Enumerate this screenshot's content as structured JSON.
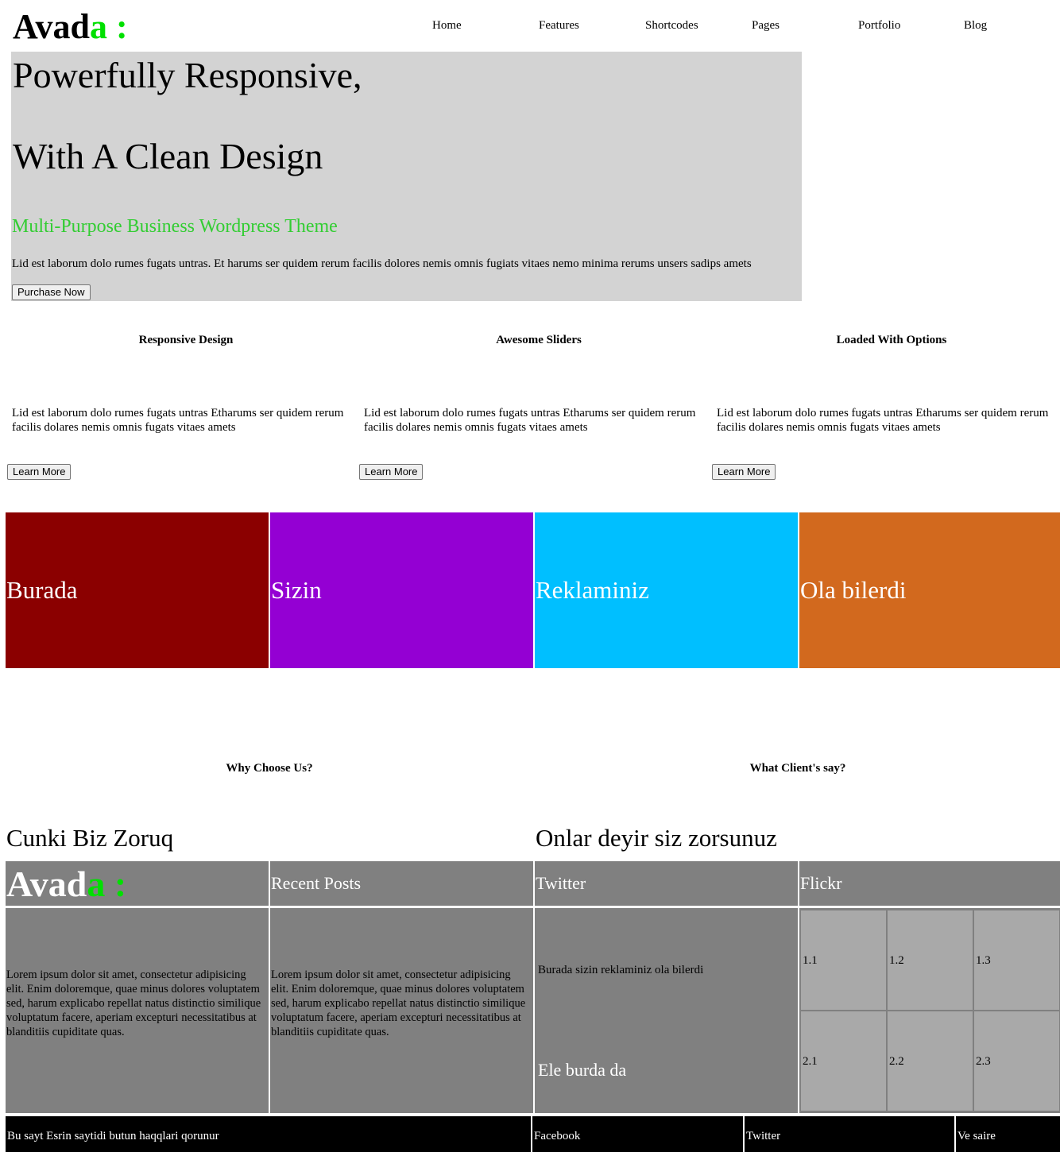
{
  "header": {
    "logo_main": "Avad",
    "logo_accent": "a :",
    "nav": [
      "Home",
      "Features",
      "Shortcodes",
      "Pages",
      "Portfolio",
      "Blog"
    ]
  },
  "hero": {
    "title_line1": "Powerfully Responsive,",
    "title_line2": "With A Clean Design",
    "subtitle": "Multi-Purpose Business Wordpress Theme",
    "text": "Lid est laborum dolo rumes fugats untras. Et harums ser quidem rerum facilis dolores nemis omnis fugiats vitaes nemo minima rerums unsers sadips amets",
    "button": "Purchase Now",
    "background": "#d3d3d3",
    "subtitle_color": "#32cd32"
  },
  "features": [
    {
      "title": "Responsive Design",
      "text": "Lid est laborum dolo rumes fugats untras Etharums ser quidem rerum facilis dolares nemis omnis fugats vitaes amets",
      "button": "Learn More"
    },
    {
      "title": "Awesome Sliders",
      "text": "Lid est laborum dolo rumes fugats untras Etharums ser quidem rerum facilis dolares nemis omnis fugats vitaes amets",
      "button": "Learn More"
    },
    {
      "title": "Loaded With Options",
      "text": "Lid est laborum dolo rumes fugats untras Etharums ser quidem rerum facilis dolares nemis omnis fugats vitaes amets",
      "button": "Learn More"
    }
  ],
  "banners": [
    {
      "label": "Burada",
      "color": "#8b0000"
    },
    {
      "label": "Sizin",
      "color": "#9400d3"
    },
    {
      "label": "Reklaminiz",
      "color": "#00bfff"
    },
    {
      "label": "Ola bilerdi",
      "color": "#d2691e"
    }
  ],
  "why": {
    "title": "Why Choose Us?",
    "text": "Cunki Biz Zoruq"
  },
  "clients": {
    "title": "What Client's say?",
    "text": "Onlar deyir siz zorsunuz"
  },
  "footer": {
    "logo_main": "Avad",
    "logo_accent": "a :",
    "recent_posts_title": "Recent Posts",
    "twitter_title": "Twitter",
    "flickr_title": "Flickr",
    "lorem": "Lorem ipsum dolor sit amet, consectetur adipisicing elit. Enim doloremque, quae minus dolores voluptatem sed, harum explicabo repellat natus distinctio similique voluptatum facere, aperiam excepturi necessitatibus at blanditiis cupiditate quas.",
    "twitter_text": "Burada sizin reklaminiz ola bilerdi",
    "twitter_big": "Ele burda da",
    "flickr_tiles": [
      "1.1",
      "1.2",
      "1.3",
      "2.1",
      "2.2",
      "2.3"
    ],
    "panel_color": "#808080",
    "tile_color": "#a9a9a9"
  },
  "bottom_bar": {
    "copyright": "Bu sayt Esrin saytidi butun haqqlari qorunur",
    "links": [
      "Facebook",
      "Twitter",
      "Ve saire"
    ]
  }
}
